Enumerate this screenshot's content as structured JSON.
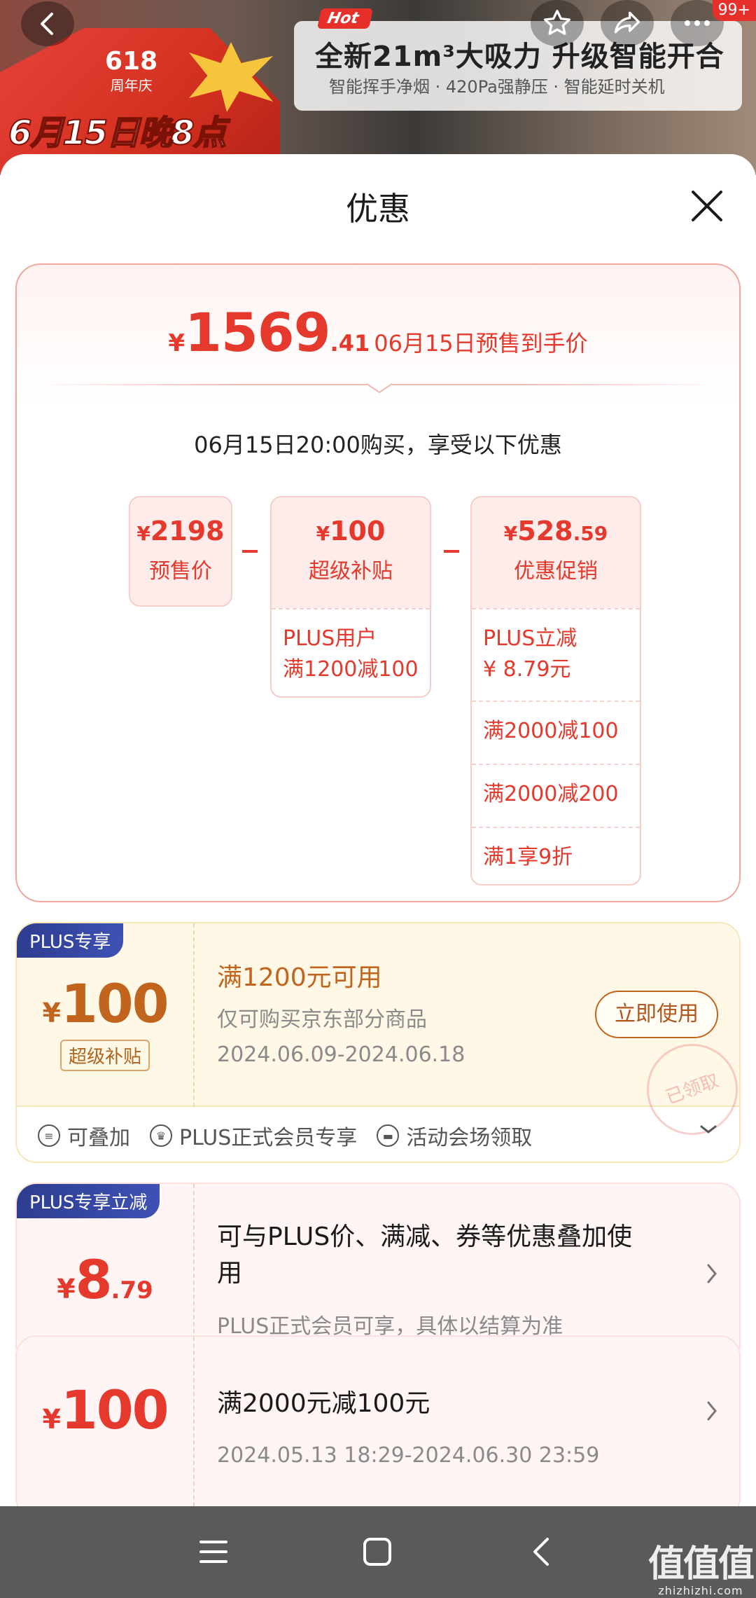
{
  "header": {
    "promo_618": "618",
    "promo_anniversary": "周年庆",
    "promo_date": "6月15日晚8点",
    "hot_label": "Hot",
    "feature_title": "全新21m³大吸力 升级智能开合",
    "feature_subtitle": "智能挥手净烟 · 420Pa强静压 · 智能延时关机",
    "notification_badge": "99+",
    "icons": [
      "back-icon",
      "star-icon",
      "share-icon",
      "more-icon"
    ]
  },
  "sheet": {
    "title": "优惠",
    "close_icon": "close-icon"
  },
  "summary": {
    "currency": "¥",
    "price_int": "1569",
    "price_dec": ".41",
    "price_desc": "06月15日预售到手价",
    "buy_note": "06月15日20:00购买，享受以下优惠",
    "boxes": [
      {
        "amount": "2198",
        "amount_dec": "",
        "label": "预售价",
        "rows": []
      },
      {
        "amount": "100",
        "amount_dec": "",
        "label": "超级补贴",
        "rows": [
          "PLUS用户\n满1200减100"
        ]
      },
      {
        "amount": "528",
        "amount_dec": ".59",
        "label": "优惠促销",
        "rows": [
          "PLUS立减\n ¥ 8.79元",
          "满2000减100",
          "满2000减200",
          "满1享9折"
        ]
      }
    ]
  },
  "coupons": [
    {
      "tag": "PLUS专享",
      "currency": "¥",
      "amount": "100",
      "sub_tag": "超级补贴",
      "title": "满1200元可用",
      "desc": "仅可购买京东部分商品",
      "date": "2024.06.09-2024.06.18",
      "button": "立即使用",
      "stamp": "已领取",
      "footer": [
        "可叠加",
        "PLUS正式会员专享",
        "活动会场领取"
      ]
    },
    {
      "tag": "PLUS专享立减",
      "currency": "¥",
      "amount": "8",
      "amount_dec": ".79",
      "title": "可与PLUS价、满减、券等优惠叠加使用",
      "desc": "PLUS正式会员可享，具体以结算为准"
    },
    {
      "currency": "¥",
      "amount": "100",
      "title": "满2000元减100元",
      "date": "2024.05.13 18:29-2024.06.30 23:59"
    }
  ],
  "navbar": {
    "icons": [
      "menu-icon",
      "home-icon",
      "back-icon"
    ],
    "watermark_main": "值值值",
    "watermark_sub": "zhizhizhi.com"
  },
  "colors": {
    "accent_red": "#e4392c",
    "gold": "#c1641e",
    "plus_blue": "#3f51b5"
  }
}
